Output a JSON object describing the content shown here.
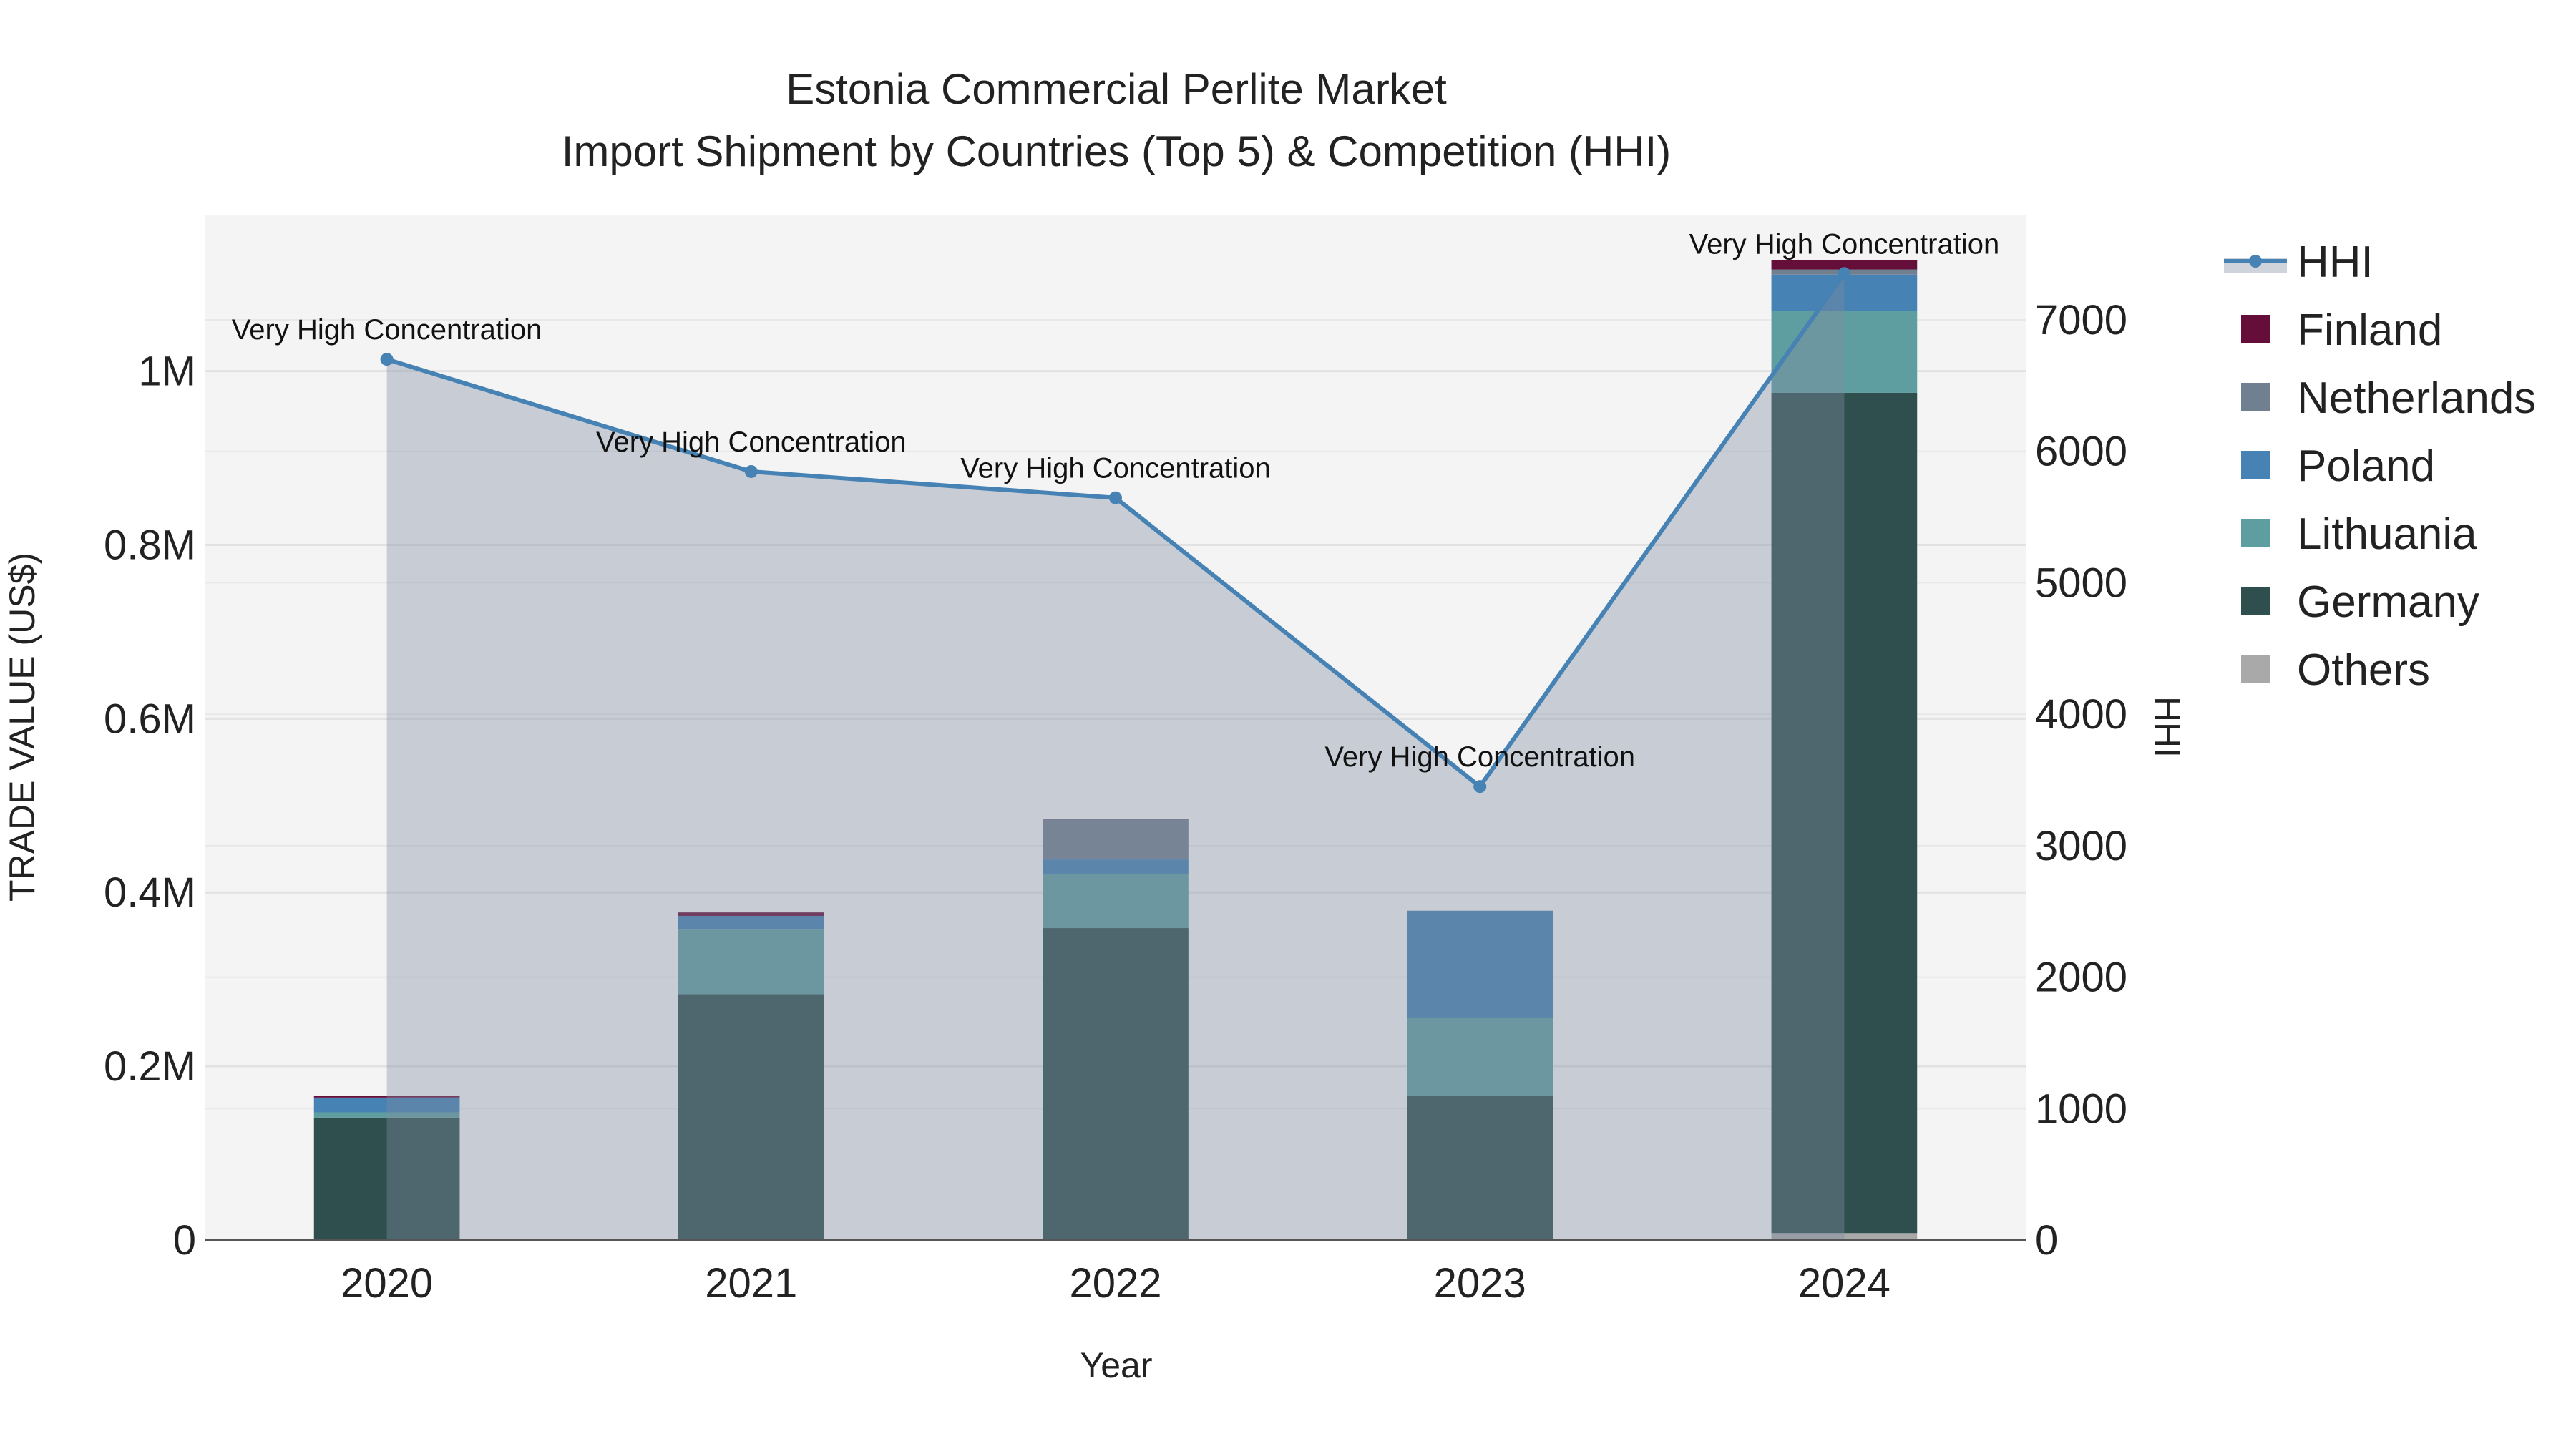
{
  "chart_data": {
    "type": "bar",
    "title": "Estonia Commercial Perlite Market",
    "subtitle": "Import Shipment by Countries (Top 5) & Competition (HHI)",
    "xlabel": "Year",
    "ylabel": "TRADE VALUE (US$)",
    "y2label": "HHI",
    "categories": [
      "2020",
      "2021",
      "2022",
      "2023",
      "2024"
    ],
    "ylim": [
      0,
      1180000
    ],
    "y2lim": [
      0,
      7800
    ],
    "yticks": [
      0,
      200000,
      400000,
      600000,
      800000,
      1000000
    ],
    "ytick_labels": [
      "0",
      "0.2M",
      "0.4M",
      "0.6M",
      "0.8M",
      "1M"
    ],
    "y2ticks": [
      0,
      1000,
      2000,
      3000,
      4000,
      5000,
      6000,
      7000
    ],
    "y2tick_labels": [
      "0",
      "1000",
      "2000",
      "3000",
      "4000",
      "5000",
      "6000",
      "7000"
    ],
    "grid": true,
    "legend_position": "right",
    "series": [
      {
        "name": "Others",
        "color": "#a9a9a9",
        "values": [
          0,
          0,
          0,
          0,
          8000
        ]
      },
      {
        "name": "Germany",
        "color": "#2f4f4f",
        "values": [
          141000,
          283000,
          359000,
          166000,
          967000
        ]
      },
      {
        "name": "Lithuania",
        "color": "#5f9ea0",
        "values": [
          6000,
          75000,
          62000,
          90000,
          94000
        ]
      },
      {
        "name": "Poland",
        "color": "#4682b4",
        "values": [
          17000,
          15000,
          17000,
          123000,
          42000
        ]
      },
      {
        "name": "Netherlands",
        "color": "#708090",
        "values": [
          0,
          0,
          46000,
          0,
          6000
        ]
      },
      {
        "name": "Finland",
        "color": "#660e3a",
        "values": [
          2000,
          4000,
          1000,
          0,
          11000
        ]
      }
    ],
    "hhi": {
      "name": "HHI",
      "color": "#4682b4",
      "values": [
        6700,
        5846,
        5646,
        3450,
        7352
      ],
      "annotations": [
        "Very High Concentration",
        "Very High Concentration",
        "Very High Concentration",
        "Very High Concentration",
        "Very High Concentration"
      ]
    },
    "legend_order": [
      "HHI",
      "Finland",
      "Netherlands",
      "Poland",
      "Lithuania",
      "Germany",
      "Others"
    ]
  }
}
